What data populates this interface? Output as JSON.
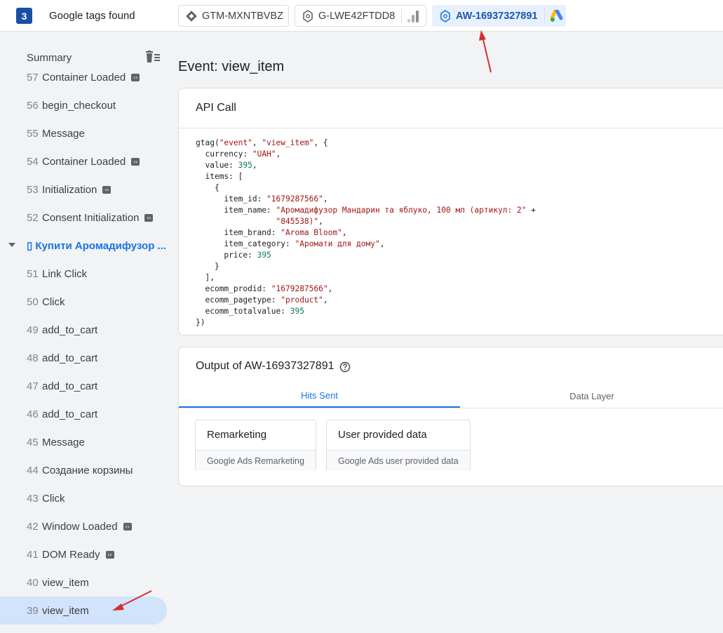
{
  "header": {
    "tag_count": "3",
    "title": "Google tags found",
    "tags": [
      {
        "id": "GTM-MXNTBVBZ",
        "icon": "gtm-diamond-icon"
      },
      {
        "id": "G-LWE42FTDD8",
        "icon": "analytics-bars-icon"
      },
      {
        "id": "AW-16937327891",
        "icon": "google-ads-icon"
      }
    ]
  },
  "sidebar": {
    "summary_label": "Summary",
    "events": [
      {
        "num": "57",
        "label": "Container Loaded",
        "code": true
      },
      {
        "num": "56",
        "label": "begin_checkout",
        "code": false
      },
      {
        "num": "55",
        "label": "Message",
        "code": false
      },
      {
        "num": "54",
        "label": "Container Loaded",
        "code": true
      },
      {
        "num": "53",
        "label": "Initialization",
        "code": true
      },
      {
        "num": "52",
        "label": "Consent Initialization",
        "code": true
      },
      {
        "group": true,
        "label": "▯ Купити Аромадифузор ..."
      },
      {
        "num": "51",
        "label": "Link Click",
        "code": false
      },
      {
        "num": "50",
        "label": "Click",
        "code": false
      },
      {
        "num": "49",
        "label": "add_to_cart",
        "code": false
      },
      {
        "num": "48",
        "label": "add_to_cart",
        "code": false
      },
      {
        "num": "47",
        "label": "add_to_cart",
        "code": false
      },
      {
        "num": "46",
        "label": "add_to_cart",
        "code": false
      },
      {
        "num": "45",
        "label": "Message",
        "code": false
      },
      {
        "num": "44",
        "label": "Создание корзины",
        "code": false
      },
      {
        "num": "43",
        "label": "Click",
        "code": false
      },
      {
        "num": "42",
        "label": "Window Loaded",
        "code": true
      },
      {
        "num": "41",
        "label": "DOM Ready",
        "code": true
      },
      {
        "num": "40",
        "label": "view_item",
        "code": false
      },
      {
        "num": "39",
        "label": "view_item",
        "code": false,
        "selected": true
      }
    ]
  },
  "main": {
    "event_title": "Event: view_item",
    "api_card_title": "API Call",
    "code": {
      "fn": "gtag(",
      "event": "\"event\"",
      "name": "\"view_item\"",
      "currency_key": "currency: ",
      "currency": "\"UAH\"",
      "value_key": "value: ",
      "value": "395",
      "items_key": "items: [",
      "item_id_key": "item_id: ",
      "item_id": "\"1679287566\"",
      "item_name_key": "item_name: ",
      "item_name_1": "\"Аромадифузор Мандарин та яблуко, 100 мл (артикул: 2\"",
      "item_name_2": "\"845538)\"",
      "item_brand_key": "item_brand: ",
      "item_brand": "\"Aroma Bloom\"",
      "item_category_key": "item_category: ",
      "item_category": "\"Аромати для дому\"",
      "price_key": "price: ",
      "price": "395",
      "ecomm_prodid_key": "ecomm_prodid: ",
      "ecomm_prodid": "\"1679287566\"",
      "ecomm_pagetype_key": "ecomm_pagetype: ",
      "ecomm_pagetype": "\"product\"",
      "ecomm_totalvalue_key": "ecomm_totalvalue: ",
      "ecomm_totalvalue": "395"
    },
    "output_title": "Output of AW-16937327891",
    "tabs": [
      "Hits Sent",
      "Data Layer"
    ],
    "hits": [
      {
        "name": "Remarketing",
        "sub": "Google Ads Remarketing"
      },
      {
        "name": "User provided data",
        "sub": "Google Ads user provided data"
      }
    ]
  },
  "colors": {
    "accent": "#1a73e8",
    "selected_bg": "#d2e3fc",
    "annotation_arrow": "#d32f2f"
  }
}
